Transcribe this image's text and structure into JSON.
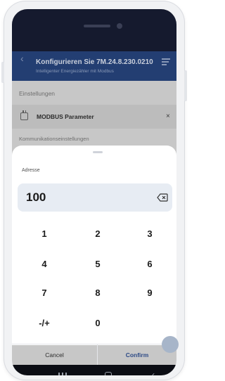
{
  "app_bar": {
    "title": "Konfigurieren Sie 7M.24.8.230.0210",
    "subtitle": "Intelligenter Energiezähler mit Modbus"
  },
  "settings": {
    "section_label": "Einstellungen",
    "param_label": "MODBUS Parameter",
    "close_label": "×",
    "communication_label": "Kommunikationseinstellungen"
  },
  "sheet": {
    "field_label": "Adresse",
    "value": "100",
    "keys": [
      "1",
      "2",
      "3",
      "4",
      "5",
      "6",
      "7",
      "8",
      "9",
      "-/+",
      "0"
    ],
    "cancel_label": "Cancel",
    "confirm_label": "Confirm"
  },
  "icons": {
    "back": "back-arrow-icon",
    "filter": "filter-icon",
    "calendar": "calendar-icon",
    "backspace": "backspace-icon"
  },
  "colors": {
    "app_bar": "#233e72",
    "accent": "#2d4a86",
    "value_box": "#e7ecf3"
  }
}
